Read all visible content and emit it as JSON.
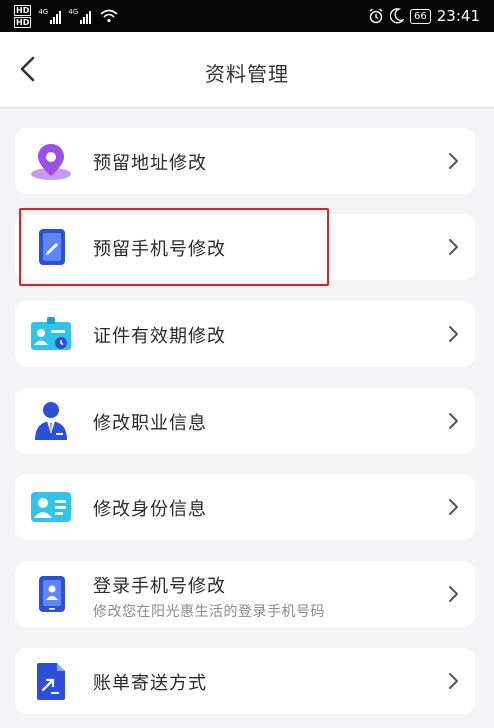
{
  "status_bar": {
    "network_badge": "HD",
    "network_type": "4G",
    "battery": "66",
    "time": "23:41",
    "icons": [
      "alarm-icon",
      "moon-icon",
      "wifi-icon",
      "signal-icon"
    ]
  },
  "header": {
    "title": "资料管理",
    "back_icon": "chevron-left-icon"
  },
  "menu": {
    "items": [
      {
        "label": "预留地址修改",
        "icon": "location-pin-icon"
      },
      {
        "label": "预留手机号修改",
        "icon": "tablet-edit-icon"
      },
      {
        "label": "证件有效期修改",
        "icon": "id-card-clock-icon"
      },
      {
        "label": "修改职业信息",
        "icon": "businessman-icon"
      },
      {
        "label": "修改身份信息",
        "icon": "id-card-icon"
      },
      {
        "label": "登录手机号修改",
        "subtitle": "修改您在阳光惠生活的登录手机号码",
        "icon": "phone-user-icon"
      },
      {
        "label": "账单寄送方式",
        "icon": "document-arrow-icon"
      }
    ]
  },
  "colors": {
    "accent_blue": "#3b5de7",
    "accent_cyan": "#2fc4e8",
    "accent_purple": "#a65be8",
    "highlight_red": "#e02020",
    "background": "#f4f4f6"
  }
}
